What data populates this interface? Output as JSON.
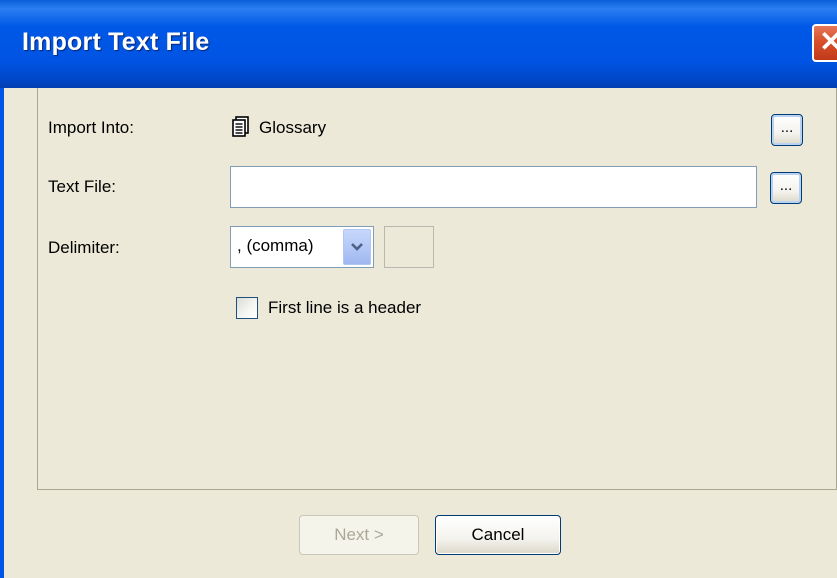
{
  "window": {
    "title": "Import Text File",
    "close_label": "✕"
  },
  "form": {
    "import_into_label": "Import Into:",
    "import_into_value": "Glossary",
    "import_into_icon": "glossary-document-icon",
    "text_file_label": "Text File:",
    "text_file_value": "",
    "delimiter_label": "Delimiter:",
    "delimiter_value": ", (comma)",
    "custom_delimiter_value": "",
    "browse_label": "...",
    "header_checkbox_label": "First line is a header",
    "header_checkbox_checked": false
  },
  "buttons": {
    "next_label": "Next >",
    "cancel_label": "Cancel"
  },
  "colors": {
    "titlebar": "#0054e3",
    "window_bg": "#ece9d8",
    "close": "#d8502a"
  }
}
